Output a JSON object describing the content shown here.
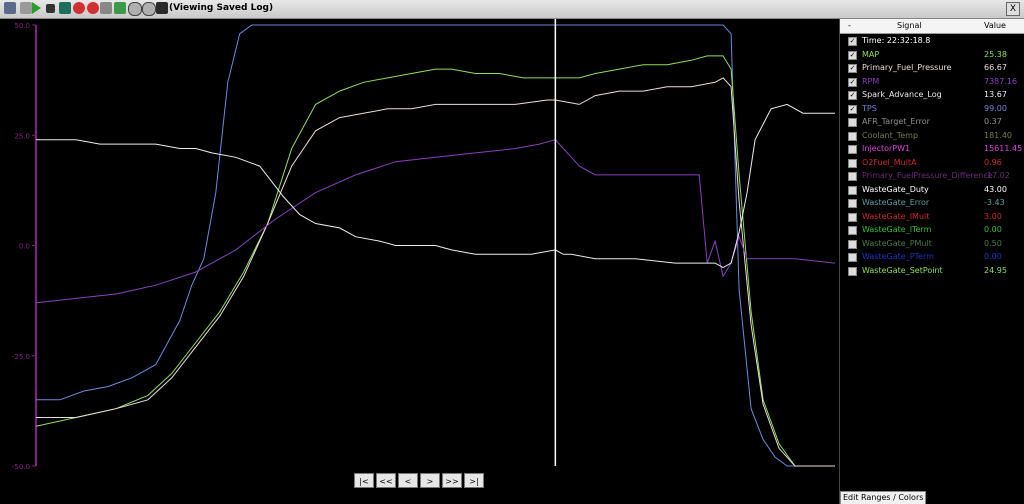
{
  "window": {
    "title": "(Viewing Saved Log)",
    "close_label": "X"
  },
  "toolbar_icons": [
    "open-icon",
    "play-icon",
    "stop-icon",
    "save-icon",
    "record-icon",
    "record-red-icon",
    "print-icon",
    "export-icon",
    "zoom-in-icon",
    "zoom-out-icon",
    "settings-icon"
  ],
  "nav_buttons": [
    "|<",
    "<<",
    "<",
    ">",
    ">>",
    ">|"
  ],
  "panel": {
    "headers": {
      "toggle": "-",
      "signal": "Signal",
      "value": "Value"
    },
    "edit_ranges_label": "Edit Ranges / Colors",
    "rows": [
      {
        "name": "Time: 22:32:18.8",
        "value": "",
        "checked": true,
        "color": "#ffffff"
      },
      {
        "name": "MAP",
        "value": "25.38",
        "checked": true,
        "color": "#8ee05a"
      },
      {
        "name": "Primary_Fuel_Pressure",
        "value": "66.67",
        "checked": true,
        "color": "#f0dcd8"
      },
      {
        "name": "RPM",
        "value": "7387.16",
        "checked": true,
        "color": "#8a3fc0"
      },
      {
        "name": "Spark_Advance_Log",
        "value": "13.67",
        "checked": true,
        "color": "#eeeeee"
      },
      {
        "name": "TPS",
        "value": "99.00",
        "checked": true,
        "color": "#6d8ae0"
      },
      {
        "name": "AFR_Target_Error",
        "value": "0.37",
        "checked": false,
        "color": "#8f8f8f"
      },
      {
        "name": "Coolant_Temp",
        "value": "181.40",
        "checked": false,
        "color": "#7a7a4a"
      },
      {
        "name": "InjectorPW1",
        "value": "15611.45",
        "checked": false,
        "color": "#e040e0"
      },
      {
        "name": "O2Fuel_MultA",
        "value": "0.96",
        "checked": false,
        "color": "#d02828"
      },
      {
        "name": "Primary_FuelPressure_Difference",
        "value": "-17.02",
        "checked": false,
        "color": "#6a2a7a"
      },
      {
        "name": "WasteGate_Duty",
        "value": "43.00",
        "checked": false,
        "color": "#ffffff"
      },
      {
        "name": "WasteGate_Error",
        "value": "-3.43",
        "checked": false,
        "color": "#5aa0a0"
      },
      {
        "name": "WasteGate_IMult",
        "value": "3.00",
        "checked": false,
        "color": "#d02828"
      },
      {
        "name": "WasteGate_ITerm",
        "value": "0.00",
        "checked": false,
        "color": "#30c030"
      },
      {
        "name": "WasteGate_PMult",
        "value": "0.50",
        "checked": false,
        "color": "#4a7a4a"
      },
      {
        "name": "WasteGate_PTerm",
        "value": "0.00",
        "checked": false,
        "color": "#2030c0"
      },
      {
        "name": "WasteGate_SetPoint",
        "value": "24.95",
        "checked": false,
        "color": "#8ee05a"
      }
    ]
  },
  "chart_data": {
    "type": "line",
    "y_tick_labels": [
      "50.0",
      "25.0",
      "0.0",
      "-25.0",
      "-50.0"
    ],
    "ylim": [
      -50,
      50
    ],
    "xlim": [
      0,
      100
    ],
    "axis_color": "#8a1c8a",
    "cursor_x": 65,
    "series": [
      {
        "name": "TPS",
        "color": "#6d8ae0",
        "x": [
          0,
          3,
          6,
          9,
          12,
          15,
          18,
          19.5,
          21,
          22.5,
          24,
          25.5,
          27,
          28.5,
          30,
          31,
          32,
          86,
          87,
          88,
          89.5,
          91,
          92.5,
          94,
          97,
          100
        ],
        "y": [
          -35,
          -35,
          -33,
          -32,
          -30,
          -27,
          -17,
          -9,
          -3,
          12,
          37,
          48,
          50,
          50,
          50,
          50,
          50,
          50,
          48,
          -10,
          -37,
          -44,
          -48,
          -50,
          -50,
          -50
        ]
      },
      {
        "name": "MAP",
        "color": "#8ee05a",
        "x": [
          0,
          5,
          10,
          14,
          17,
          20,
          23,
          26,
          29,
          32,
          35,
          38,
          41,
          44,
          47,
          50,
          52,
          55,
          58,
          61,
          64,
          65,
          68,
          70,
          73,
          76,
          79,
          82,
          84,
          86,
          87,
          88,
          89.5,
          91,
          93,
          95,
          97,
          100
        ],
        "y": [
          -41,
          -39,
          -37,
          -34,
          -29,
          -22,
          -15,
          -6,
          5,
          22,
          32,
          35,
          37,
          38,
          39,
          40,
          40,
          39,
          39,
          38,
          38,
          38,
          38,
          39,
          40,
          41,
          41,
          42,
          43,
          43,
          40,
          16,
          -15,
          -35,
          -45,
          -50,
          -50,
          -50
        ]
      },
      {
        "name": "Primary_Fuel_Pressure",
        "color": "#f0dcd8",
        "x": [
          0,
          5,
          10,
          14,
          17,
          20,
          23,
          26,
          29,
          32,
          35,
          38,
          41,
          44,
          47,
          50,
          55,
          60,
          64,
          65,
          68,
          70,
          73,
          76,
          79,
          82,
          85,
          86,
          87,
          88,
          89.5,
          91,
          93,
          95,
          97,
          100
        ],
        "y": [
          -39,
          -39,
          -37,
          -35,
          -30,
          -23,
          -16,
          -7,
          5,
          18,
          26,
          29,
          30,
          31,
          31,
          32,
          32,
          32,
          33,
          33,
          32,
          34,
          35,
          35,
          36,
          36,
          37,
          38,
          36,
          10,
          -18,
          -36,
          -46,
          -50,
          -50,
          -50
        ]
      },
      {
        "name": "RPM",
        "color": "#8a3fc0",
        "x": [
          0,
          5,
          10,
          15,
          20,
          25,
          30,
          35,
          40,
          45,
          50,
          55,
          60,
          63,
          65,
          66,
          67,
          68,
          69,
          70,
          73,
          76,
          80,
          83,
          84,
          85,
          86,
          87,
          88,
          89,
          90,
          92,
          95,
          100
        ],
        "y": [
          -13,
          -12,
          -11,
          -9,
          -6,
          -1,
          6,
          12,
          16,
          19,
          20,
          21,
          22,
          23,
          24,
          22,
          20,
          18,
          17,
          16,
          16,
          16,
          16,
          16,
          -4,
          1,
          -7,
          -4,
          2,
          -3,
          -3,
          -3,
          -3,
          -4
        ]
      },
      {
        "name": "Spark_Advance_Log",
        "color": "#eeeeee",
        "x": [
          0,
          5,
          8,
          10,
          15,
          18,
          20,
          22,
          25,
          28,
          31,
          33,
          35,
          38,
          40,
          43,
          45,
          50,
          52,
          55,
          60,
          62,
          65,
          66,
          67,
          70,
          75,
          80,
          85,
          86,
          87,
          88,
          89,
          90,
          92,
          94,
          96,
          100
        ],
        "y": [
          24,
          24,
          23,
          23,
          23,
          22,
          22,
          21,
          20,
          18,
          11,
          7,
          5,
          4,
          2,
          1,
          0,
          0,
          -1,
          -2,
          -2,
          -2,
          -1,
          -2,
          -2,
          -3,
          -3,
          -4,
          -4,
          -5,
          -4,
          3,
          12,
          24,
          31,
          32,
          30,
          30
        ]
      }
    ]
  }
}
